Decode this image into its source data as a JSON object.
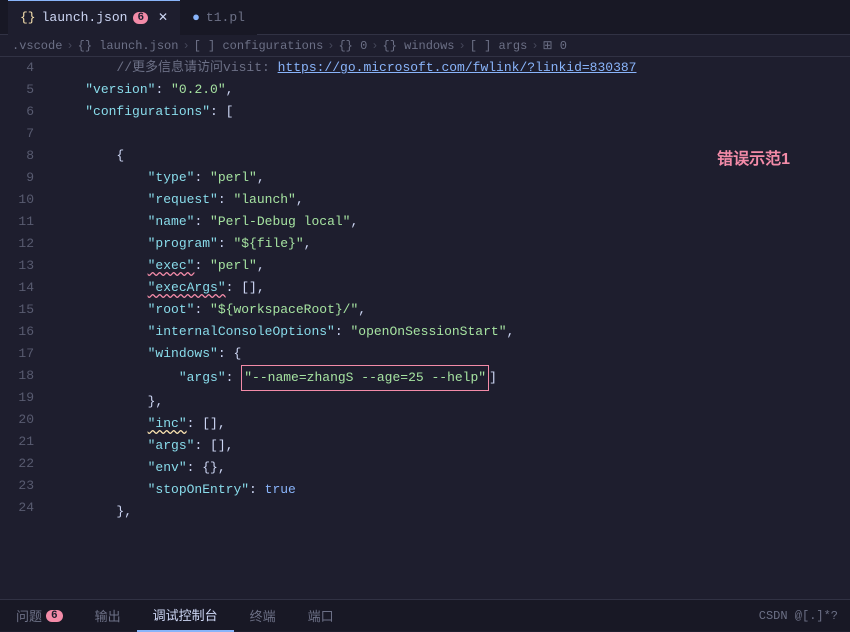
{
  "tabs": [
    {
      "id": "launch-json",
      "icon": "{}",
      "label": "launch.json",
      "badge": "6",
      "active": true
    },
    {
      "id": "t1-pl",
      "icon": "t1",
      "label": "t1.pl",
      "active": false
    }
  ],
  "breadcrumb": [
    ".vscode",
    "{} launch.json",
    "[ ] configurations",
    "{} 0",
    "{} windows",
    "[ ] args",
    "⊞ 0"
  ],
  "lines": [
    {
      "num": 4,
      "content": "comment_link"
    },
    {
      "num": 5,
      "content": "version"
    },
    {
      "num": 6,
      "content": "configurations"
    },
    {
      "num": 7,
      "content": "empty"
    },
    {
      "num": 8,
      "content": "open_brace"
    },
    {
      "num": 9,
      "content": "type"
    },
    {
      "num": 10,
      "content": "request"
    },
    {
      "num": 11,
      "content": "name"
    },
    {
      "num": 12,
      "content": "program"
    },
    {
      "num": 13,
      "content": "exec"
    },
    {
      "num": 14,
      "content": "execArgs"
    },
    {
      "num": 15,
      "content": "root"
    },
    {
      "num": 16,
      "content": "internalConsoleOptions"
    },
    {
      "num": 17,
      "content": "windows"
    },
    {
      "num": 18,
      "content": "args_windows"
    },
    {
      "num": 19,
      "content": "close_obj"
    },
    {
      "num": 20,
      "content": "inc"
    },
    {
      "num": 21,
      "content": "args"
    },
    {
      "num": 22,
      "content": "env"
    },
    {
      "num": 23,
      "content": "stopOnEntry"
    },
    {
      "num": 24,
      "content": "close_brace"
    }
  ],
  "error_label": "错误示范1",
  "status": {
    "tabs": [
      "问题",
      "输出",
      "调试控制台",
      "终端",
      "端口"
    ],
    "active_tab": "调试控制台",
    "badge": "6",
    "right_text": "CSDN @[.]*?"
  }
}
